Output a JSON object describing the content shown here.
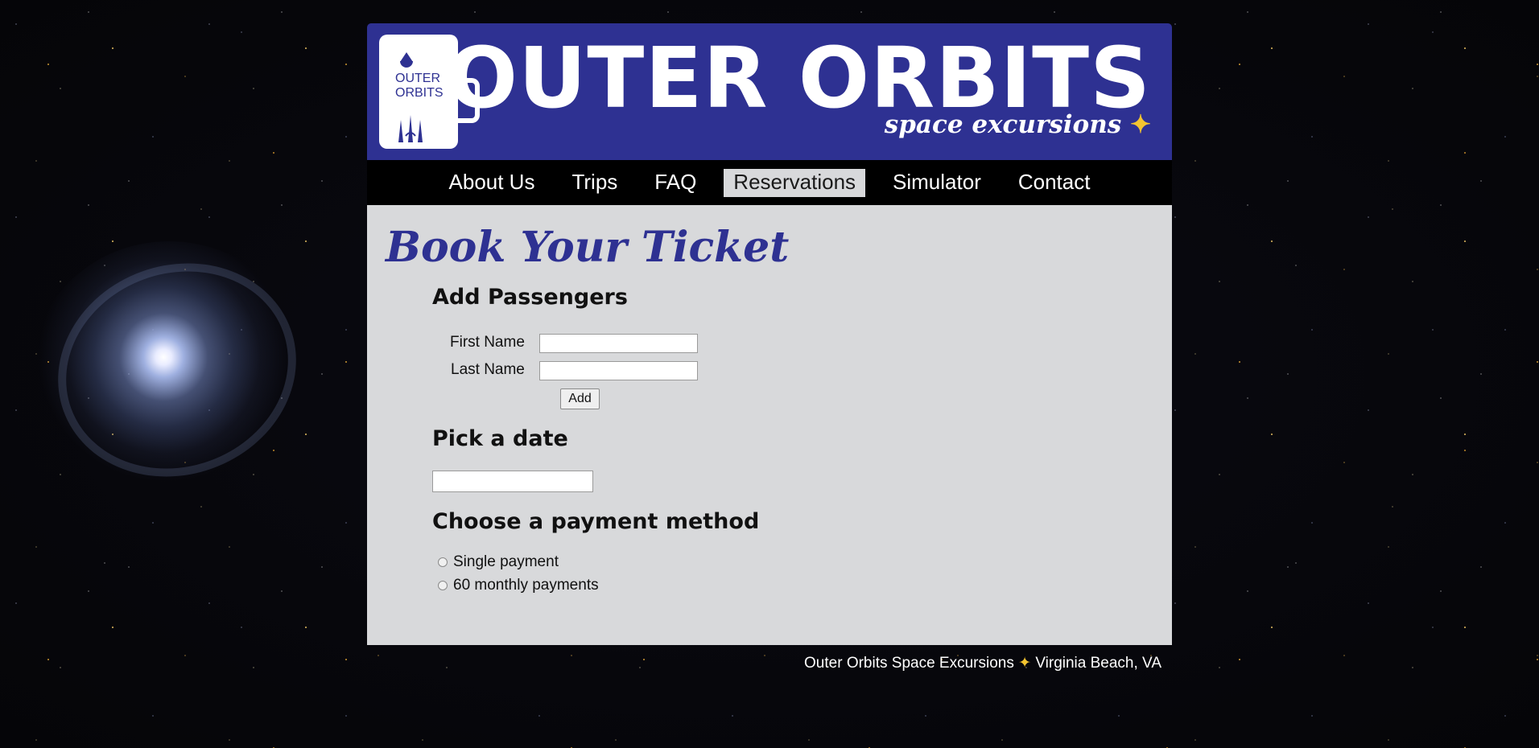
{
  "brand": {
    "logo_line1": "OUTER",
    "logo_line2": "ORBITS",
    "title": "OUTER ORBITS",
    "tagline": "space excursions",
    "sparkle": "✦",
    "colors": {
      "primary": "#2e3192",
      "accent": "#f4c430",
      "panel": "#d8d9db"
    }
  },
  "nav": {
    "items": [
      {
        "label": "About Us",
        "active": false
      },
      {
        "label": "Trips",
        "active": false
      },
      {
        "label": "FAQ",
        "active": false
      },
      {
        "label": "Reservations",
        "active": true
      },
      {
        "label": "Simulator",
        "active": false
      },
      {
        "label": "Contact",
        "active": false
      }
    ]
  },
  "main": {
    "heading": "Book Your Ticket",
    "passengers": {
      "heading": "Add Passengers",
      "first_name_label": "First Name",
      "first_name_value": "",
      "last_name_label": "Last Name",
      "last_name_value": "",
      "add_label": "Add"
    },
    "date": {
      "heading": "Pick a date",
      "value": ""
    },
    "payment": {
      "heading": "Choose a payment method",
      "options": [
        {
          "label": "Single payment",
          "checked": false
        },
        {
          "label": "60 monthly payments",
          "checked": false
        }
      ]
    }
  },
  "footer": {
    "left": "Outer Orbits Space Excursions",
    "sparkle": "✦",
    "right": "Virginia Beach, VA"
  }
}
